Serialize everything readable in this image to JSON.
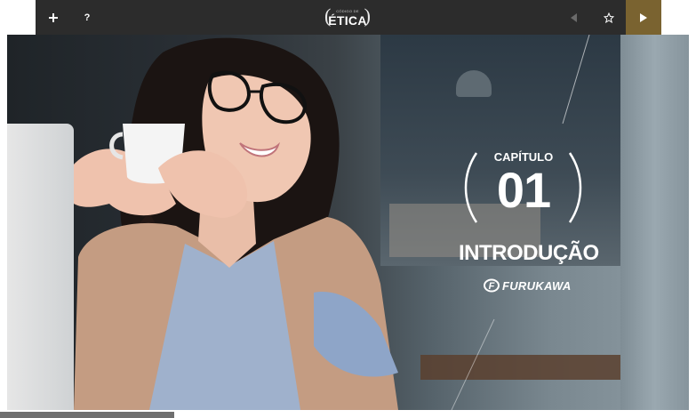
{
  "toolbar": {
    "plus_icon": "plus-icon",
    "help_label": "?",
    "title_small": "CÓDIGO DE",
    "title_main": "ÉTICA",
    "prev_icon": "chevron-left-icon",
    "favorite_icon": "star-icon",
    "next_icon": "play-icon",
    "accent_color": "#7a6330"
  },
  "chapter": {
    "label": "CAPÍTULO",
    "number": "01",
    "title": "INTRODUÇÃO",
    "brand": "FURUKAWA"
  },
  "progress": {
    "value": 0.25
  }
}
